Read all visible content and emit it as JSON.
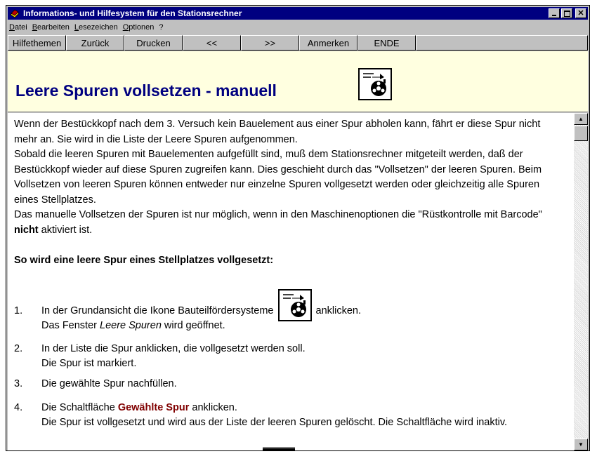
{
  "window": {
    "title": "Informations- und Hilfesystem für den Stationsrechner",
    "controls": [
      "minimize",
      "maximize",
      "close"
    ]
  },
  "menu": [
    "Datei",
    "Bearbeiten",
    "Lesezeichen",
    "Optionen",
    "?"
  ],
  "toolbar": [
    "Hilfethemen",
    "Zurück",
    "Drucken",
    "<<",
    ">>",
    "Anmerken",
    "ENDE"
  ],
  "header": {
    "title": "Leere Spuren vollsetzen - manuell",
    "icon": "feeder-system-icon"
  },
  "intro": {
    "p1": "Wenn der Bestückkopf nach dem 3. Versuch kein Bauelement aus einer Spur abholen kann, fährt er diese Spur nicht mehr an. Sie wird in die Liste der Leere Spuren aufgenommen.",
    "p2": "Sobald die leeren Spuren mit Bauelementen aufgefüllt sind, muß dem Stationsrechner mitgeteilt werden, daß der Bestückkopf wieder auf diese Spuren zugreifen kann. Dies geschieht durch das \"Vollsetzen\" der leeren Spuren. Beim Vollsetzen von leeren Spuren können entweder nur einzelne Spuren vollgesetzt werden oder gleichzeitig alle Spuren eines Stellplatzes.",
    "p3_a": "Das manuelle Vollsetzen der Spuren ist nur möglich, wenn in den Maschinenoptionen die \"Rüstkontrolle mit Barcode\" ",
    "p3_bold": "nicht",
    "p3_b": " aktiviert ist."
  },
  "subheading": "So wird eine leere Spur eines Stellplatzes vollgesetzt:",
  "steps": [
    {
      "num": "1.",
      "a": "In der Grundansicht die Ikone Bauteilfördersysteme",
      "b": "anklicken.",
      "c": "Das Fenster",
      "d": "Leere Spuren",
      "e": "wird geöffnet."
    },
    {
      "num": "2.",
      "a": "In der Liste die Spur anklicken, die vollgesetzt werden soll.",
      "b": "Die Spur ist markiert."
    },
    {
      "num": "3.",
      "a": "Die gewählte Spur nachfüllen."
    },
    {
      "num": "4.",
      "a": "Die Schaltfläche",
      "link": "Gewählte Spur",
      "b": "anklicken.",
      "c": "Die Spur ist vollgesetzt und wird aus der Liste der leeren Spuren gelöscht. Die Schaltfläche wird inaktiv."
    }
  ],
  "colors": {
    "titlebar": "#000080",
    "header_bg": "#ffffe0",
    "heading": "#000080",
    "link": "#800000"
  }
}
